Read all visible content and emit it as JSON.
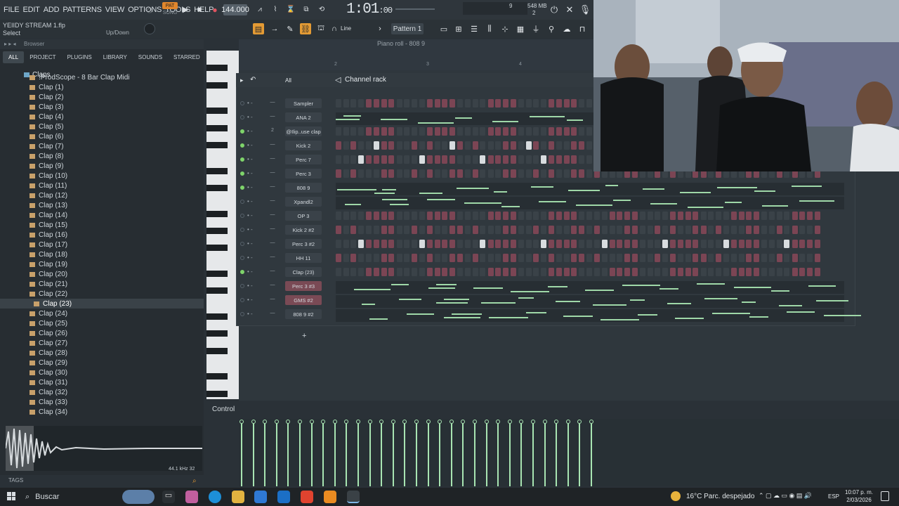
{
  "menu": [
    "FILE",
    "EDIT",
    "ADD",
    "PATTERNS",
    "VIEW",
    "OPTIONS",
    "TOOLS",
    "HELP"
  ],
  "transport": {
    "pat_label": "PAT",
    "song_label": "SONG",
    "tempo": "144.000",
    "time_main": "1:01",
    "time_sub": ":00",
    "cpu_mem": "548 MB",
    "cpu_num": "9",
    "poly": "2"
  },
  "hint": {
    "title": "YEIIDY STREAM 1.flp",
    "action": "Select",
    "mode": "Up/Down"
  },
  "toolbar": {
    "snap": "Line",
    "pattern": "Pattern 1"
  },
  "browser": {
    "title": "Browser",
    "tabs": [
      "ALL",
      "PROJECT",
      "PLUGINS",
      "LIBRARY",
      "SOUNDS",
      "STARRED"
    ],
    "folder": "Claps",
    "first_item": "!ProdScope - 8 Bar Clap Midi",
    "items": [
      "Clap  (1)",
      "Clap  (2)",
      "Clap  (3)",
      "Clap  (4)",
      "Clap  (5)",
      "Clap  (6)",
      "Clap  (7)",
      "Clap  (8)",
      "Clap  (9)",
      "Clap  (10)",
      "Clap  (11)",
      "Clap  (12)",
      "Clap  (13)",
      "Clap  (14)",
      "Clap  (15)",
      "Clap  (16)",
      "Clap  (17)",
      "Clap  (18)",
      "Clap  (19)",
      "Clap  (20)",
      "Clap  (21)",
      "Clap  (22)",
      "Clap  (23)",
      "Clap  (24)",
      "Clap  (25)",
      "Clap  (26)",
      "Clap  (27)",
      "Clap  (28)",
      "Clap  (29)",
      "Clap  (30)",
      "Clap  (31)",
      "Clap  (32)",
      "Clap  (33)",
      "Clap  (34)"
    ],
    "selected_index": 22,
    "sample_info": "44.1 kHz 32",
    "tags_label": "TAGS"
  },
  "piano_roll": {
    "title": "Piano roll - 808 9",
    "bar_markers": [
      "2",
      "3",
      "4"
    ]
  },
  "channel_rack": {
    "title": "Channel rack",
    "filter": "All",
    "channels": [
      {
        "name": "Sampler",
        "led": false,
        "kind": "steps"
      },
      {
        "name": "ANA 2",
        "led": false,
        "kind": "roll"
      },
      {
        "name": "@Ilip..use clap",
        "led": true,
        "kind": "steps",
        "num": "2"
      },
      {
        "name": "Kick 2",
        "led": true,
        "kind": "steps"
      },
      {
        "name": "Perc 7",
        "led": true,
        "kind": "steps"
      },
      {
        "name": "Perc 3",
        "led": true,
        "kind": "steps"
      },
      {
        "name": "808 9",
        "led": true,
        "kind": "roll"
      },
      {
        "name": "Xpandl2",
        "led": false,
        "kind": "roll"
      },
      {
        "name": "OP 3",
        "led": false,
        "kind": "steps"
      },
      {
        "name": "Kick 2 #2",
        "led": false,
        "kind": "steps"
      },
      {
        "name": "Perc 3 #2",
        "led": false,
        "kind": "steps"
      },
      {
        "name": "HH 11",
        "led": false,
        "kind": "steps"
      },
      {
        "name": "Clap  (23)",
        "led": true,
        "kind": "steps"
      },
      {
        "name": "Perc 3 #3",
        "led": false,
        "kind": "roll",
        "red": true
      },
      {
        "name": "GMS #2",
        "led": false,
        "kind": "roll",
        "red": true
      },
      {
        "name": "808 9 #2",
        "led": false,
        "kind": "roll"
      }
    ],
    "add_label": "+"
  },
  "control": {
    "label": "Control"
  },
  "taskbar": {
    "search_placeholder": "Buscar",
    "weather": "16°C  Parc. despejado",
    "lang": "ESP",
    "time": "10:07 p. m.",
    "date": "2/03/2026"
  }
}
